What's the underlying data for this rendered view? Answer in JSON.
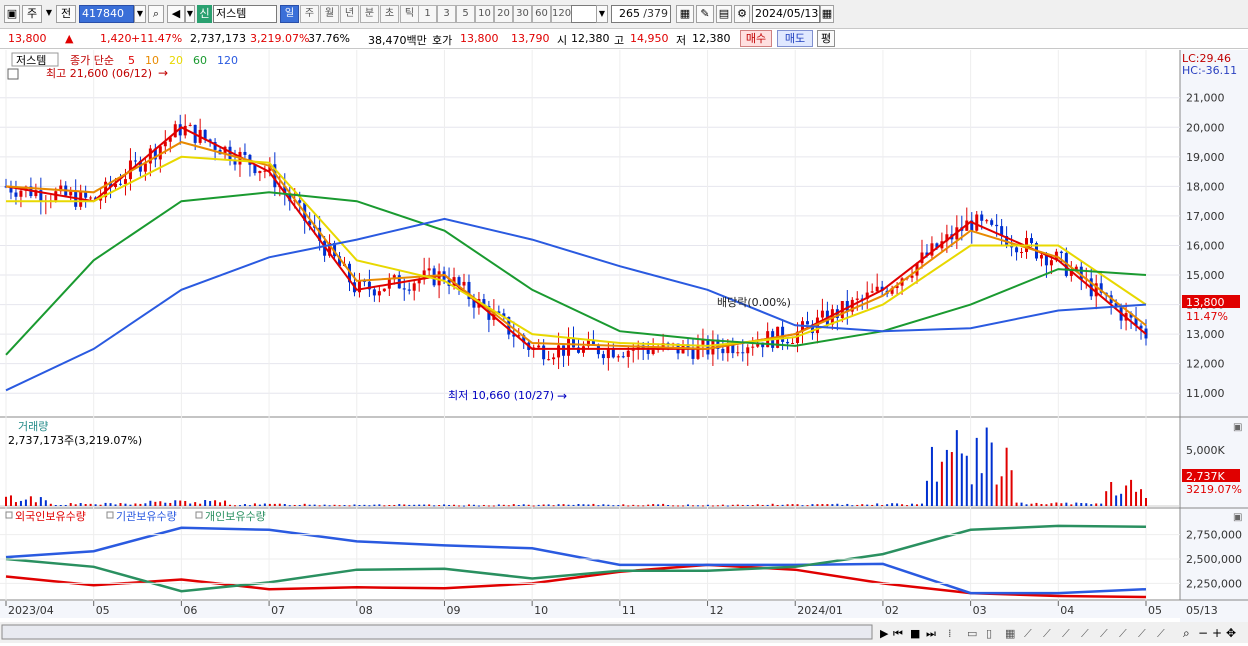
{
  "toolbar": {
    "mode_label": "주",
    "prev_label": "전",
    "code_value": "417840",
    "stock_badge": "신",
    "stock_name": "저스템",
    "periods": [
      {
        "label": "일",
        "active": true
      },
      {
        "label": "주",
        "active": false
      },
      {
        "label": "월",
        "active": false
      },
      {
        "label": "년",
        "active": false
      },
      {
        "label": "분",
        "active": false
      },
      {
        "label": "초",
        "active": false
      },
      {
        "label": "틱",
        "active": false
      }
    ],
    "intervals": [
      "1",
      "3",
      "5",
      "10",
      "20",
      "30",
      "60",
      "120"
    ],
    "count_value": "265",
    "count_total": "/379",
    "date_value": "2024/05/13"
  },
  "infobar": {
    "price": "13,800",
    "change": "1,420",
    "change_pct": "+11.47%",
    "volume": "2,737,173",
    "vol_pct": "3,219.07%",
    "turnover": "37.76%",
    "amount": "38,470백만",
    "quote_label": "호가",
    "ask": "13,800",
    "bid": "13,790",
    "open_label": "시",
    "open": "12,380",
    "high_label": "고",
    "high": "14,950",
    "low_label": "저",
    "low": "12,380",
    "buy_label": "매수",
    "sell_label": "매도",
    "avg_label": "평"
  },
  "price_panel": {
    "legend_name": "저스템",
    "legend_type": "종가 단순",
    "ma_labels": [
      {
        "label": "5",
        "color": "#e00000"
      },
      {
        "label": "10",
        "color": "#e88a00"
      },
      {
        "label": "20",
        "color": "#e8d800"
      },
      {
        "label": "60",
        "color": "#1a9a30"
      },
      {
        "label": "120",
        "color": "#2a5ae0"
      }
    ],
    "max_note": "최고 21,600 (06/12)",
    "min_note": "최저 10,660 (10/27)",
    "dividend_note": "배당락(0.00%)",
    "lc": "LC:29.46",
    "hc": "HC:-36.11",
    "y_labels": [
      "21,000",
      "20,000",
      "19,000",
      "18,000",
      "17,000",
      "16,000",
      "15,000",
      "14,000",
      "13,000",
      "12,000",
      "11,000"
    ],
    "price_tag": "13,800",
    "pct_tag": "11.47%"
  },
  "volume_panel": {
    "title": "거래량",
    "summary": "2,737,173주(3,219.07%)",
    "y_label": "5,000K",
    "tag_value": "2,737K",
    "tag_pct": "3219.07%"
  },
  "holding_panel": {
    "legend": [
      {
        "label": "외국인보유수량",
        "color": "#e00000"
      },
      {
        "label": "기관보유수량",
        "color": "#2a5ae0"
      },
      {
        "label": "개인보유수량",
        "color": "#2a9060"
      }
    ],
    "y_labels": [
      "2,750,000",
      "2,500,000",
      "2,250,000"
    ]
  },
  "x_axis": {
    "labels": [
      "2023/04",
      "05",
      "06",
      "07",
      "08",
      "09",
      "10",
      "11",
      "12",
      "2024/01",
      "02",
      "03",
      "04",
      "05"
    ],
    "end_label": "05/13"
  },
  "chart_data": [
    {
      "type": "line",
      "title": "",
      "x": [
        "2023/04",
        "05",
        "06",
        "07",
        "08",
        "09",
        "10",
        "11",
        "12",
        "2024/01",
        "02",
        "03",
        "04",
        "05"
      ],
      "ylim": [
        10500,
        21600
      ],
      "series": [
        {
          "name": "5",
          "values": [
            18000,
            17500,
            20000,
            18500,
            14500,
            15000,
            12500,
            12500,
            12500,
            13000,
            14500,
            16800,
            15500,
            13000
          ]
        },
        {
          "name": "10",
          "values": [
            18000,
            17800,
            19500,
            18700,
            14800,
            15000,
            12700,
            12600,
            12500,
            13000,
            14300,
            16500,
            15600,
            13300
          ]
        },
        {
          "name": "20",
          "values": [
            17500,
            17500,
            19000,
            18800,
            15500,
            14800,
            13000,
            12700,
            12600,
            12900,
            14000,
            16000,
            16000,
            14000
          ]
        },
        {
          "name": "60",
          "values": [
            12300,
            15500,
            17500,
            17800,
            17500,
            16500,
            14500,
            13100,
            12800,
            12600,
            13100,
            14000,
            15200,
            15000
          ]
        },
        {
          "name": "120",
          "values": [
            11100,
            12500,
            14500,
            15600,
            16200,
            16900,
            16200,
            15300,
            14500,
            13300,
            13100,
            13200,
            13800,
            14000
          ]
        }
      ]
    },
    {
      "type": "bar",
      "title": "거래량",
      "unit": "K",
      "categories": [
        "2023/04",
        "05",
        "06",
        "07",
        "08",
        "09",
        "10",
        "11",
        "12",
        "2024/01",
        "02",
        "03",
        "04",
        "05"
      ],
      "values": [
        1100,
        300,
        600,
        250,
        200,
        150,
        180,
        200,
        160,
        220,
        300,
        7500,
        350,
        2737
      ],
      "ylim": [
        0,
        8000
      ]
    },
    {
      "type": "line",
      "title": "",
      "x": [
        "2023/04",
        "05",
        "06",
        "07",
        "08",
        "09",
        "10",
        "11",
        "12",
        "2024/01",
        "02",
        "03",
        "04",
        "05"
      ],
      "ylim": [
        2100000,
        2900000
      ],
      "series": [
        {
          "name": "외국인보유수량",
          "values": [
            2320000,
            2230000,
            2290000,
            2190000,
            2210000,
            2200000,
            2250000,
            2370000,
            2440000,
            2390000,
            2250000,
            2150000,
            2120000,
            2110000
          ]
        },
        {
          "name": "기관보유수량",
          "values": [
            2520000,
            2580000,
            2820000,
            2800000,
            2680000,
            2640000,
            2610000,
            2440000,
            2440000,
            2440000,
            2450000,
            2150000,
            2150000,
            2190000
          ]
        },
        {
          "name": "개인보유수량",
          "values": [
            2500000,
            2420000,
            2170000,
            2260000,
            2390000,
            2400000,
            2300000,
            2380000,
            2380000,
            2420000,
            2550000,
            2800000,
            2840000,
            2830000
          ]
        }
      ]
    }
  ]
}
